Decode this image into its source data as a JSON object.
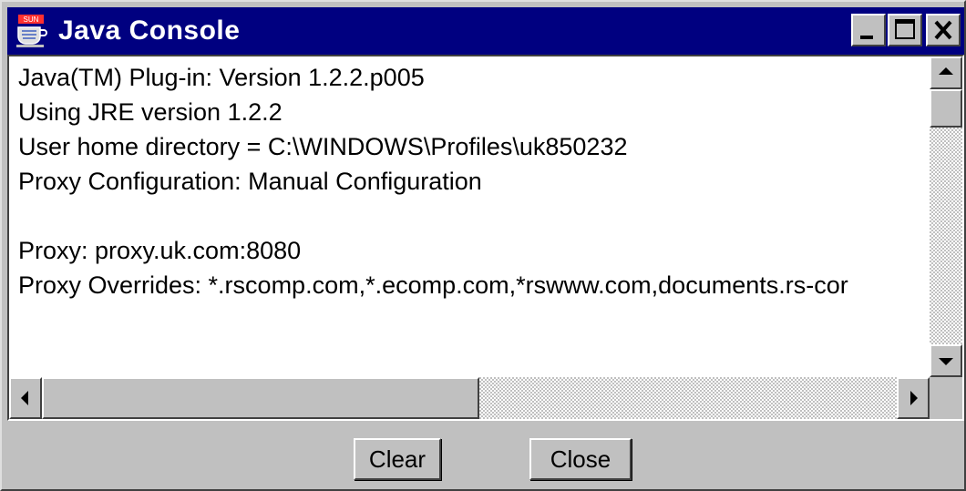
{
  "window": {
    "title": "Java Console"
  },
  "titlebar_buttons": {
    "minimize": "minimize-icon",
    "maximize": "maximize-icon",
    "close": "close-icon"
  },
  "console": {
    "lines": [
      "Java(TM) Plug-in: Version 1.2.2.p005",
      "Using JRE version 1.2.2",
      "User home directory = C:\\WINDOWS\\Profiles\\uk850232",
      "Proxy Configuration: Manual Configuration",
      "",
      "Proxy: proxy.uk.com:8080",
      "Proxy Overrides: *.rscomp.com,*.ecomp.com,*rswww.com,documents.rs-cor"
    ]
  },
  "buttons": {
    "clear_label": "Clear",
    "close_label": "Close"
  },
  "colors": {
    "titlebar": "#000080",
    "face": "#c0c0c0",
    "text_area": "#ffffff"
  }
}
